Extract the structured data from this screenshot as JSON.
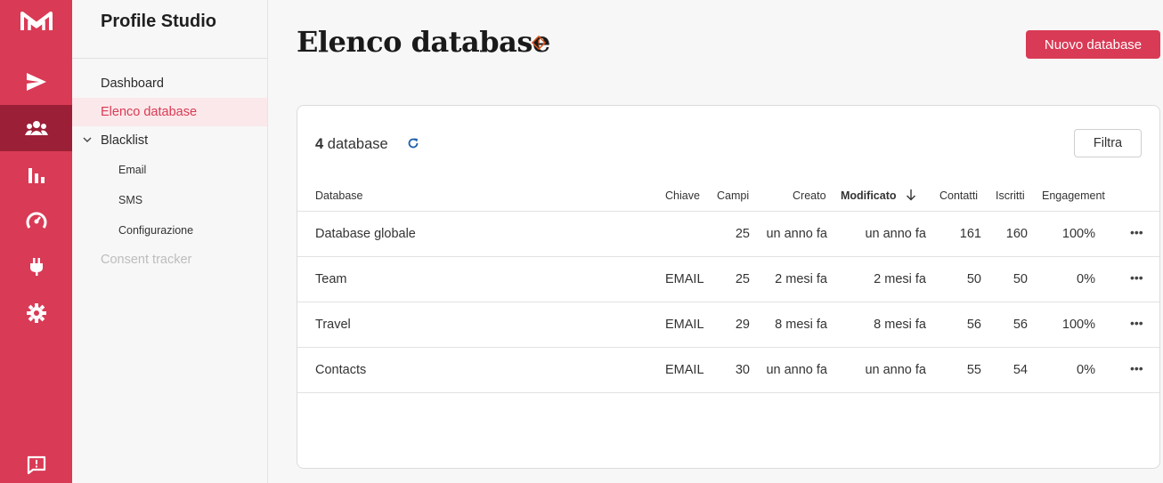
{
  "sidebar": {
    "app_title": "Profile Studio",
    "rail_icons": [
      "logo-icon",
      "send-icon",
      "contacts-icon",
      "analytics-icon",
      "speedometer-icon",
      "plug-icon",
      "settings-icon",
      "feedback-icon"
    ],
    "nav": {
      "dashboard": "Dashboard",
      "elenco_database": "Elenco database",
      "blacklist": "Blacklist",
      "email": "Email",
      "sms": "SMS",
      "configurazione": "Configurazione",
      "consent_tracker": "Consent tracker"
    }
  },
  "header": {
    "title": "Elenco database",
    "new_button": "Nuovo database"
  },
  "toolbar": {
    "count_number": "4",
    "count_label": "database",
    "filter_button": "Filtra"
  },
  "table": {
    "columns": {
      "database": "Database",
      "chiave": "Chiave",
      "campi": "Campi",
      "creato": "Creato",
      "modificato": "Modificato",
      "contatti": "Contatti",
      "iscritti": "Iscritti",
      "engagement": "Engagement"
    },
    "rows": [
      {
        "name": "Database globale",
        "key": "",
        "fields": "25",
        "created": "un anno fa",
        "modified": "un anno fa",
        "contacts": "161",
        "subscribers": "160",
        "engagement": "100%"
      },
      {
        "name": "Team",
        "key": "EMAIL",
        "fields": "25",
        "created": "2 mesi fa",
        "modified": "2 mesi fa",
        "contacts": "50",
        "subscribers": "50",
        "engagement": "0%"
      },
      {
        "name": "Travel",
        "key": "EMAIL",
        "fields": "29",
        "created": "8 mesi fa",
        "modified": "8 mesi fa",
        "contacts": "56",
        "subscribers": "56",
        "engagement": "100%"
      },
      {
        "name": "Contacts",
        "key": "EMAIL",
        "fields": "30",
        "created": "un anno fa",
        "modified": "un anno fa",
        "contacts": "55",
        "subscribers": "54",
        "engagement": "0%"
      }
    ],
    "row_menu": "•••"
  },
  "colors": {
    "accent": "#d93a55",
    "rail_active": "#9b1f36",
    "nav_active_bg": "#fbe8ea"
  }
}
